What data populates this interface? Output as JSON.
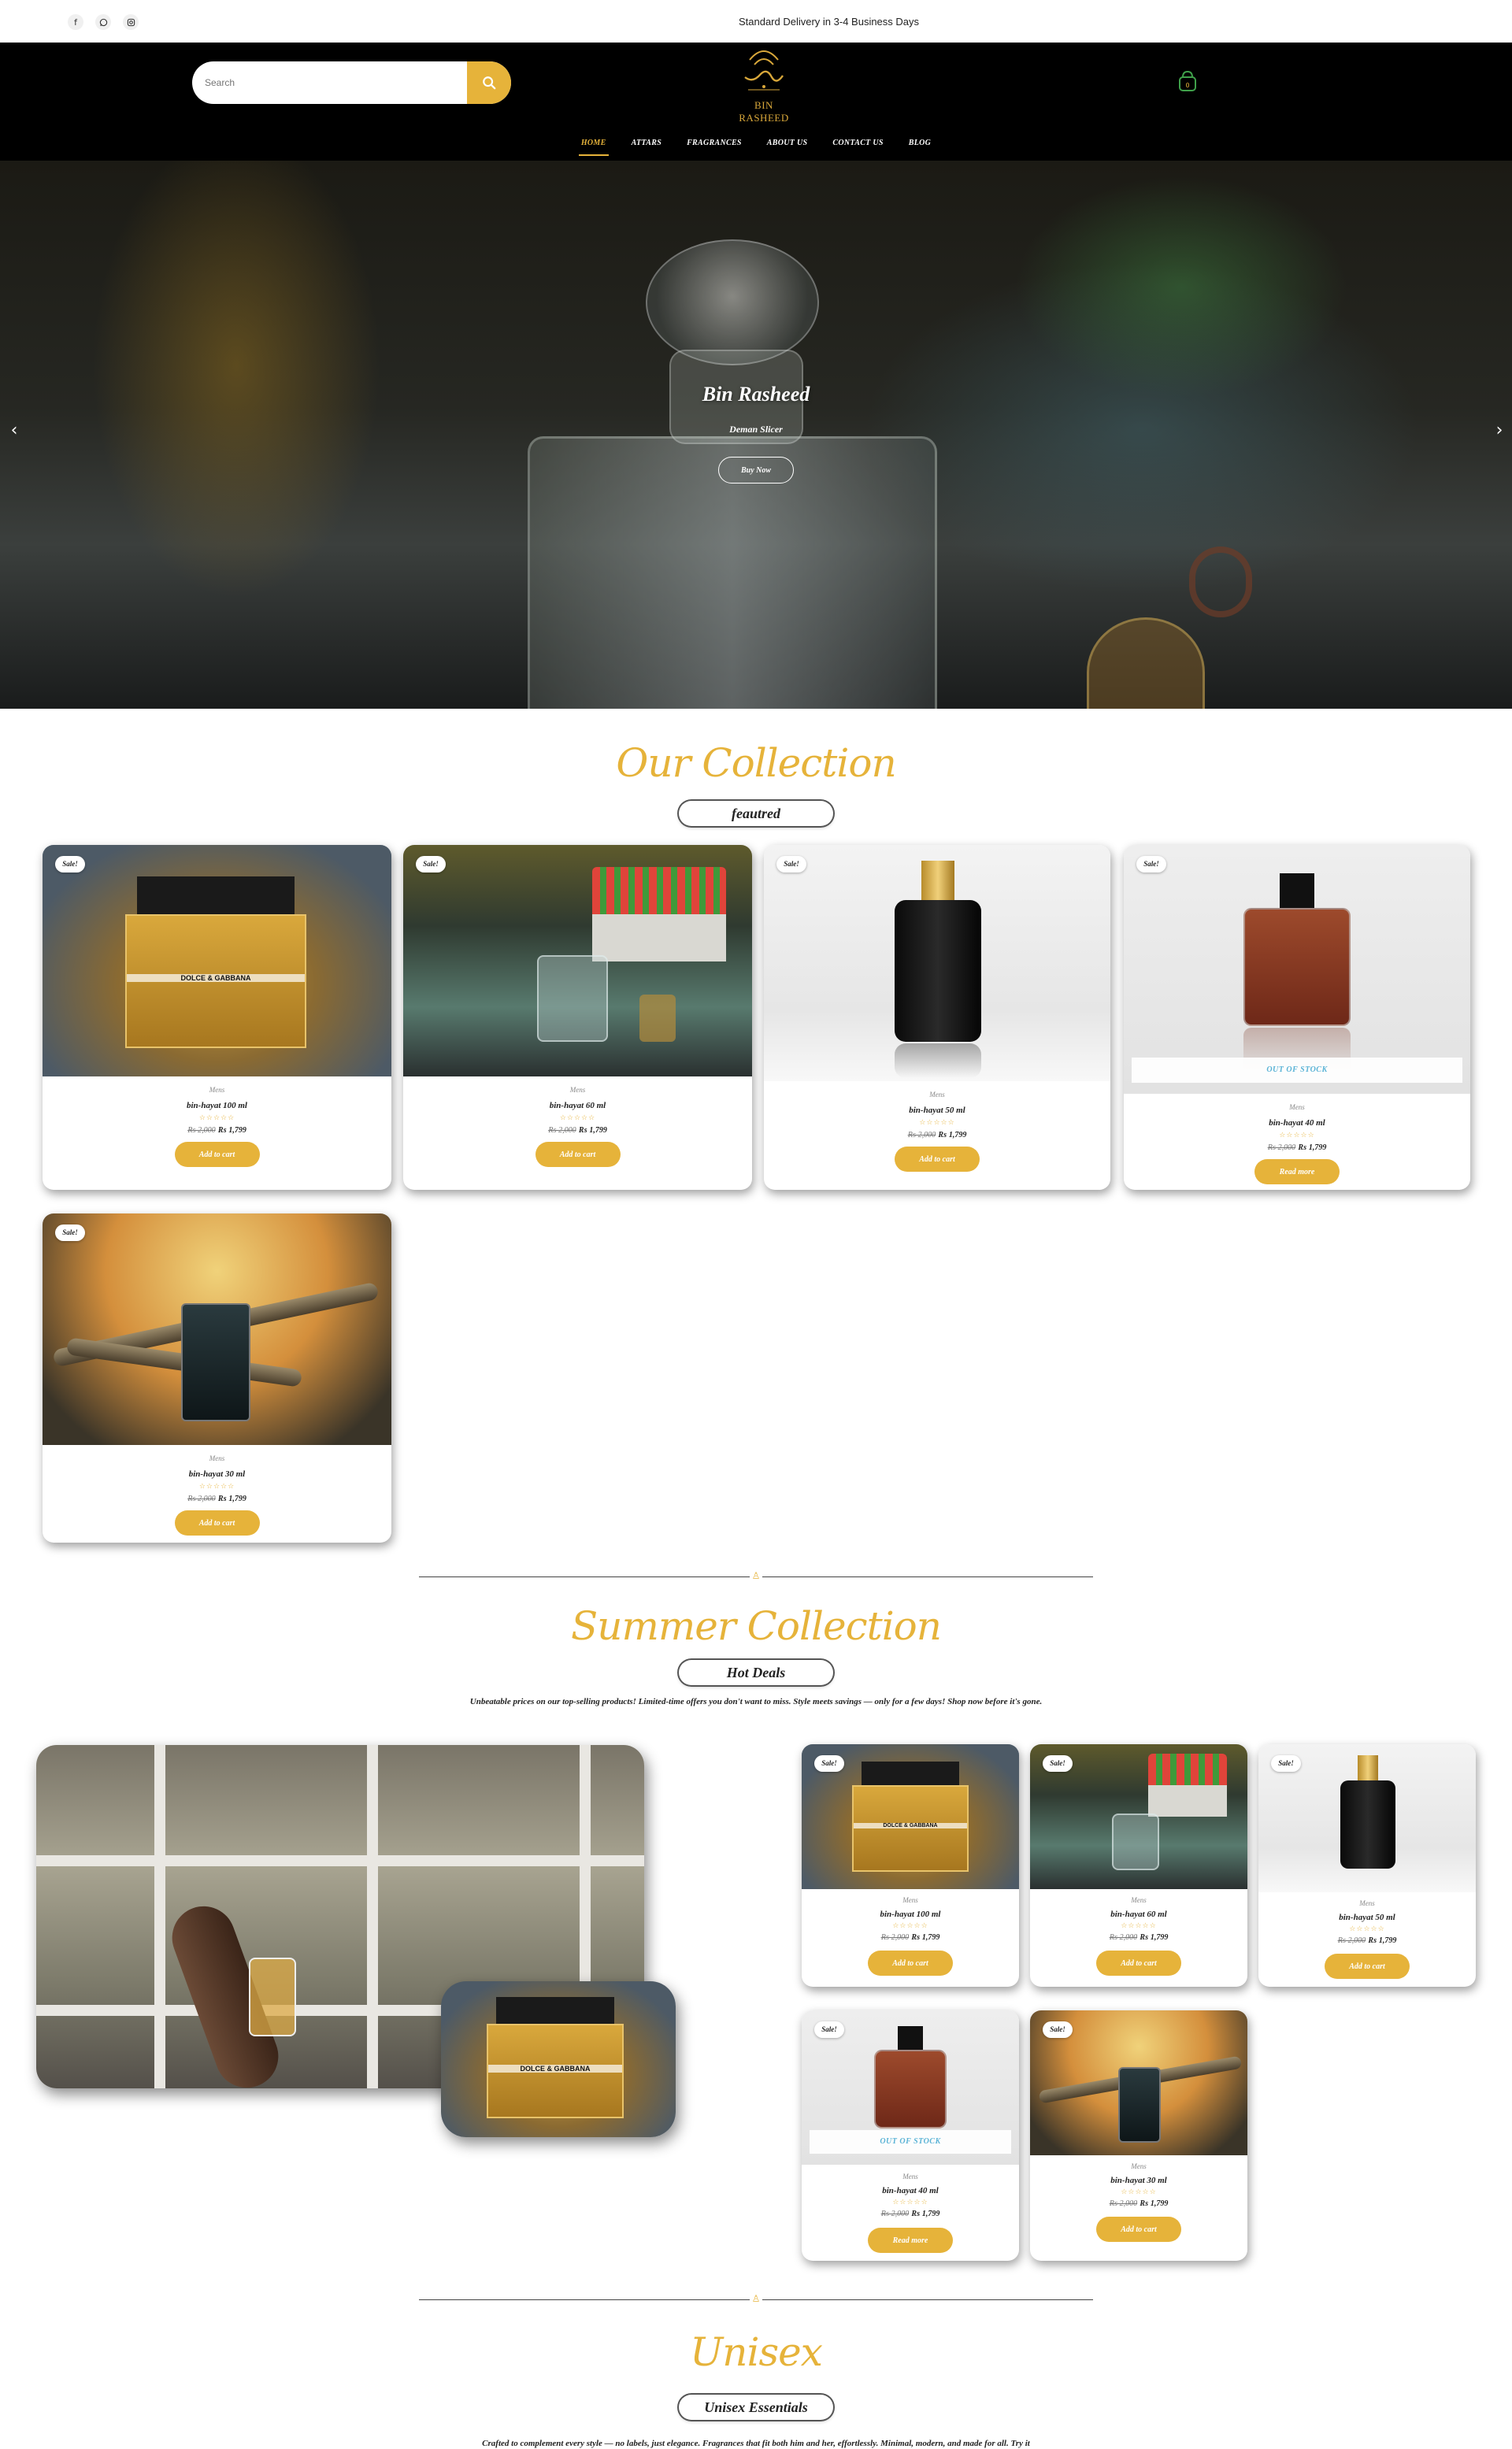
{
  "topbar": {
    "social": [
      "f",
      "w",
      "i"
    ],
    "delivery": "Standard Delivery in 3-4 Business Days"
  },
  "header": {
    "search_placeholder": "Search",
    "logo_text": "BIN RASHEED",
    "nav": [
      "HOME",
      "ATTARS",
      "FRAGRANCES",
      "ABOUT US",
      "CONTACT US",
      "BLOG"
    ],
    "active_nav": "HOME",
    "cart_count": "0"
  },
  "hero": {
    "title": "Bin Rasheed",
    "subtitle": "Deman Slicer",
    "button": "Buy Now"
  },
  "collection": {
    "title": "Our Collection",
    "pill": "feautred",
    "products": [
      {
        "name": "bin-hayat 100 ml",
        "category": "Mens",
        "old_price": "₨ 2,000",
        "new_price": "₨ 1,799",
        "button": "Add to cart",
        "badge": "Sale!",
        "stock": ""
      },
      {
        "name": "bin-hayat 60 ml",
        "category": "Mens",
        "old_price": "₨ 2,000",
        "new_price": "₨ 1,799",
        "button": "Add to cart",
        "badge": "Sale!",
        "stock": ""
      },
      {
        "name": "bin-hayat 50 ml",
        "category": "Mens",
        "old_price": "₨ 2,000",
        "new_price": "₨ 1,799",
        "button": "Add to cart",
        "badge": "Sale!",
        "stock": ""
      },
      {
        "name": "bin-hayat 40 ml",
        "category": "Mens",
        "old_price": "₨ 2,000",
        "new_price": "₨ 1,799",
        "button": "Read more",
        "badge": "Sale!",
        "stock": "OUT OF STOCK"
      },
      {
        "name": "bin-hayat 30 ml",
        "category": "Mens",
        "old_price": "₨ 2,000",
        "new_price": "₨ 1,799",
        "button": "Add to cart",
        "badge": "Sale!",
        "stock": ""
      }
    ]
  },
  "summer": {
    "title": "Summer Collection",
    "pill": "Hot Deals",
    "text": "Unbeatable prices on our top-selling products! Limited-time offers you don't want to miss. Style meets savings — only for a few days! Shop now before it's gone.",
    "rating": "☆☆☆☆☆"
  },
  "unisex": {
    "title": "Unisex",
    "pill": "Unisex Essentials",
    "text": "Crafted to complement every style — no labels, just elegance. Fragrances that fit both him and her, effortlessly. Minimal, modern, and made for all. Try it"
  },
  "colors": {
    "gold": "#e6b33a",
    "header_bg": "#000000",
    "out_of_stock": "#5ab3d6"
  }
}
